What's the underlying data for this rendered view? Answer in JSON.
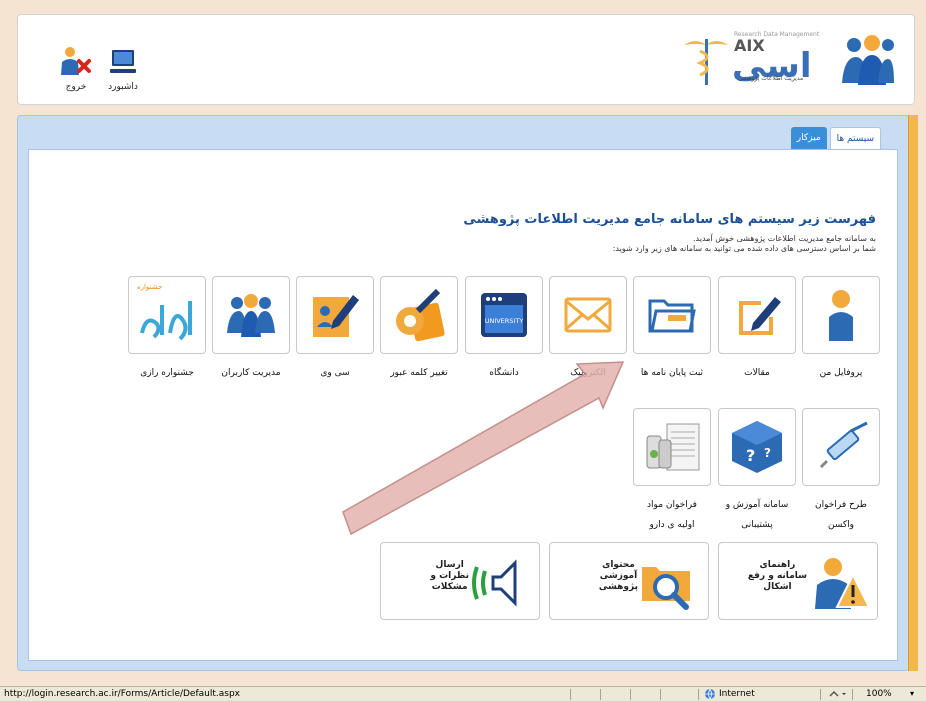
{
  "header": {
    "logout_label": "خروج",
    "dashboard_label": "داشبورد",
    "logo_text": "Research Data Management",
    "logo_subtitle": "مدیریت اطلاعات پژوهشی"
  },
  "tabs": [
    {
      "label": "سیستم ها",
      "active": true
    },
    {
      "label": "میزکار",
      "active": false
    }
  ],
  "main": {
    "title": "فهرست زیر سیستم های سامانه جامع مدیریت اطلاعات پژوهشی",
    "intro_line1": "به سامانه جامع مدیریت اطلاعات پژوهشی خوش آمدید.",
    "intro_line2": "شما بر اساس دسترسی های داده شده می توانید به سامانه های زیر وارد شوید:"
  },
  "tiles_row1": [
    {
      "label": "پروفایل من",
      "icon": "profile-icon"
    },
    {
      "label": "مقالات",
      "icon": "article-icon"
    },
    {
      "label": "ثبت پایان نامه ها",
      "icon": "thesis-folder-icon"
    },
    {
      "label": "الکترونیک",
      "icon": "envelope-icon"
    },
    {
      "label": "دانشگاه",
      "icon": "university-window-icon"
    },
    {
      "label": "تغییر کلمه عبور",
      "icon": "password-key-icon"
    },
    {
      "label": "سی وی",
      "icon": "cv-icon"
    },
    {
      "label": "مدیریت کاربران",
      "icon": "users-icon"
    },
    {
      "label": "جشنواره رازی",
      "icon": "razi-festival-logo",
      "logo_text": "جشنواره"
    }
  ],
  "tiles_row2": [
    {
      "label_line1": "طرح فراخوان",
      "label_line2": "واکسن",
      "icon": "vaccine-syringe-icon"
    },
    {
      "label_line1": "سامانه آموزش و",
      "label_line2": "پشتیبانی",
      "icon": "support-help-icon"
    },
    {
      "label_line1": "فراخوان مواد",
      "label_line2": "اولیه ی دارو",
      "icon": "drug-materials-icon"
    }
  ],
  "wide_tiles": [
    {
      "line1": "راهنمای",
      "line2": "سامانه و رفع",
      "line3": "اشکال",
      "icon": "help-warning-user-icon"
    },
    {
      "line1": "محتوای",
      "line2": "آموزشی",
      "line3": "پژوهشی",
      "icon": "search-content-icon"
    },
    {
      "line1": "ارسال",
      "line2": "نظرات و",
      "line3": "مشکلات",
      "icon": "feedback-speaker-icon"
    }
  ],
  "status_bar": {
    "url": "http://login.research.ac.ir/Forms/Article/Default.aspx",
    "zone": "Internet",
    "zoom": "100%"
  },
  "colors": {
    "title_blue": "#1c4f95",
    "panel_blue": "#c8dcf4",
    "tab_blue": "#3b8fd9",
    "orange_strip": "#f2b94a",
    "annotation_arrow": "#d99a96"
  }
}
